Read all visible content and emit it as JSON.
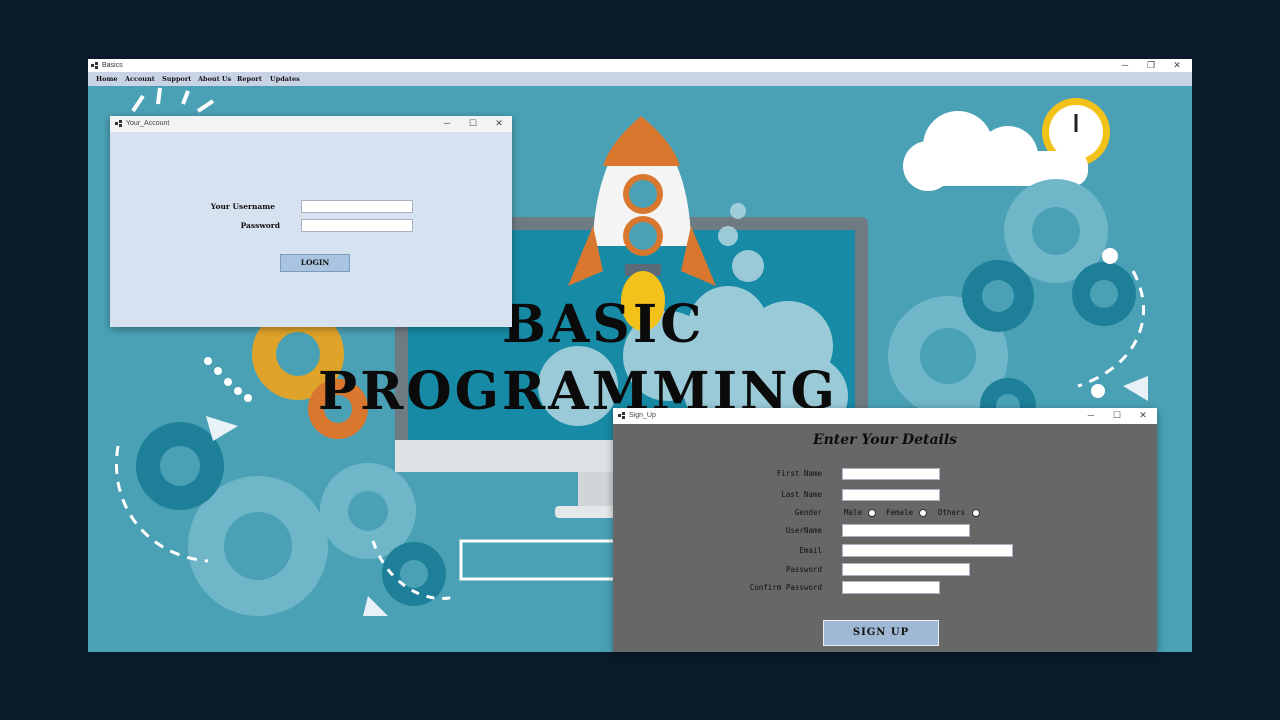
{
  "main_window": {
    "title": "Basics",
    "controls": {
      "minimize": "─",
      "restore": "❐",
      "close": "✕"
    }
  },
  "menu": [
    "Home",
    "Account",
    "Support",
    "About Us",
    "Report",
    "Updates"
  ],
  "background": {
    "headline_line1": "BASIC",
    "headline_line2": "PROGRAMMING",
    "colors": {
      "sky": "#4aa1b5",
      "gear_dark": "#1d7f98",
      "gear_light": "#6fb7c8",
      "orange_gear": "#e0a32a",
      "rocket_orange": "#d9772f"
    }
  },
  "account_window": {
    "title": "Your_Account",
    "username_label": "Your Username",
    "password_label": "Password",
    "username_value": "",
    "password_value": "",
    "login_button": "LOGIN",
    "controls": {
      "minimize": "─",
      "maximize": "☐",
      "close": "✕"
    }
  },
  "signup_window": {
    "title": "Sign_Up",
    "heading": "Enter Your Details",
    "labels": {
      "first_name": "First Name",
      "last_name": "Last Name",
      "gender": "Gender",
      "username": "UserName",
      "email": "Email",
      "password": "Password",
      "confirm_password": "Confirm Password"
    },
    "gender_options": [
      "Male",
      "Female",
      "Others"
    ],
    "values": {
      "first_name": "",
      "last_name": "",
      "username": "",
      "email": "",
      "password": "",
      "confirm_password": ""
    },
    "signup_button": "SIGN UP",
    "controls": {
      "minimize": "─",
      "maximize": "☐",
      "close": "✕"
    }
  }
}
